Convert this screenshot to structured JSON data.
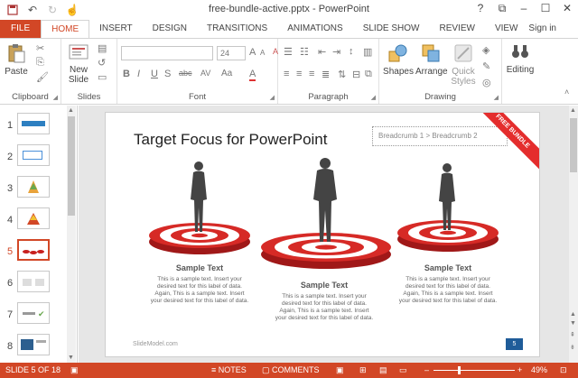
{
  "window": {
    "title": "free-bundle-active.pptx - PowerPoint",
    "help": "?",
    "minimize": "–",
    "maximize": "☐",
    "close": "✕",
    "restore": "⧉"
  },
  "qat": {
    "save": "💾",
    "undo": "↶",
    "redo": "↻",
    "touch": "☝"
  },
  "tabs": [
    "FILE",
    "HOME",
    "INSERT",
    "DESIGN",
    "TRANSITIONS",
    "ANIMATIONS",
    "SLIDE SHOW",
    "REVIEW",
    "VIEW"
  ],
  "signin": "Sign in",
  "ribbon": {
    "clipboard": {
      "label": "Clipboard",
      "paste": "Paste"
    },
    "slides": {
      "label": "Slides",
      "new_slide_1": "New",
      "new_slide_2": "Slide"
    },
    "font": {
      "label": "Font",
      "font_name": "",
      "font_size": "24",
      "bold": "B",
      "italic": "I",
      "underline": "U",
      "shadow": "S",
      "strike": "abc",
      "spacing": "AV",
      "case": "Aa",
      "color": "A",
      "grow": "A",
      "shrink": "A",
      "clear": "A"
    },
    "paragraph": {
      "label": "Paragraph"
    },
    "drawing": {
      "label": "Drawing",
      "shapes": "Shapes",
      "arrange": "Arrange",
      "quick_1": "Quick",
      "quick_2": "Styles"
    },
    "editing": {
      "label": "Editing"
    }
  },
  "thumbnails": [
    "1",
    "2",
    "3",
    "4",
    "5",
    "6",
    "7",
    "8"
  ],
  "active_slide_index": 5,
  "slide": {
    "title": "Target Focus for PowerPoint",
    "breadcrumb": "Breadcrumb 1 > Breadcrumb 2",
    "banner": "FREE BUNDLE",
    "captions": [
      {
        "heading": "Sample Text",
        "body": "This is a sample text. Insert your desired text for this label of data. Again, This is a sample text. Insert your desired text for this label of data."
      },
      {
        "heading": "Sample Text",
        "body": "This is a sample text. Insert your desired text for this label of data. Again, This is a sample text. Insert your desired text for this label of data."
      },
      {
        "heading": "Sample Text",
        "body": "This is a sample text. Insert your desired text for this label of data. Again, This is a sample text. Insert your desired text for this label of data."
      }
    ],
    "footer": "SlideModel.com",
    "number": "5"
  },
  "status": {
    "slide": "SLIDE 5 OF 18",
    "notes": "NOTES",
    "comments": "COMMENTS",
    "zoom": "49%"
  },
  "colors": {
    "accent": "#d24726",
    "target_red": "#c8201e"
  }
}
